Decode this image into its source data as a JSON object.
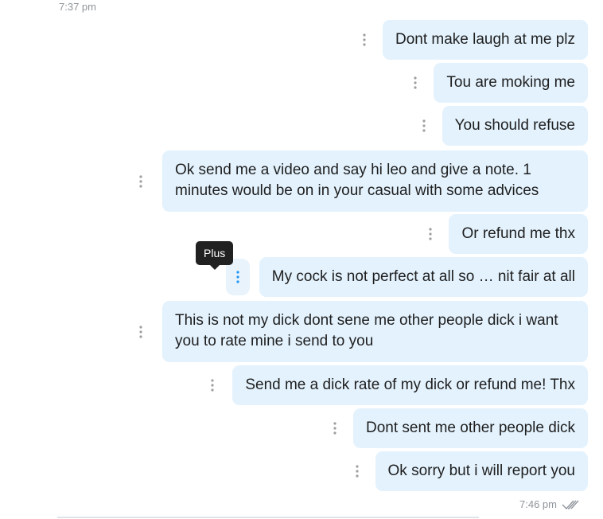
{
  "timestamps": {
    "top": "7:37 pm",
    "bottom": "7:46 pm"
  },
  "messages": [
    {
      "text": "Dont make laugh at me plz"
    },
    {
      "text": "Tou are moking me"
    },
    {
      "text": "You should refuse"
    },
    {
      "text": "Ok send me a video and say hi leo and give a note. 1 minutes would be on in your casual with some advices"
    },
    {
      "text": "Or refund me thx"
    },
    {
      "text": "My cock is not perfect at all so … nit fair at all"
    },
    {
      "text": "This is not my dick dont sene me other people dick i want you to rate mine i send to you"
    },
    {
      "text": "Send me a dick rate of my dick or refund me! Thx"
    },
    {
      "text": "Dont sent me other people dick"
    },
    {
      "text": "Ok sorry but i will report you"
    }
  ],
  "tooltip": {
    "text": "Plus"
  },
  "colors": {
    "bubble": "#e3f2fd",
    "active_kebab": "#2196f3",
    "kebab": "#9e9e9e"
  },
  "icons": {
    "more_actions": "vertical-dots-icon",
    "read_receipt": "double-check-icon"
  }
}
